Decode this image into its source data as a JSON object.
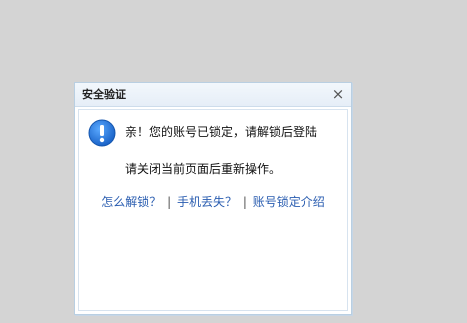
{
  "dialog": {
    "title": "安全验证",
    "close_symbol": "×",
    "message_line1": "亲！您的账号已锁定，请解锁后登陆",
    "message_line2": "请关闭当前页面后重新操作。",
    "info_icon": "info-icon",
    "links": [
      {
        "label": "怎么解锁？"
      },
      {
        "label": "手机丢失？"
      },
      {
        "label": "账号锁定介绍"
      }
    ],
    "separator": "|"
  },
  "colors": {
    "background": "#d4d4d4",
    "link": "#2a5db0",
    "icon_blue": "#1e73d8"
  }
}
